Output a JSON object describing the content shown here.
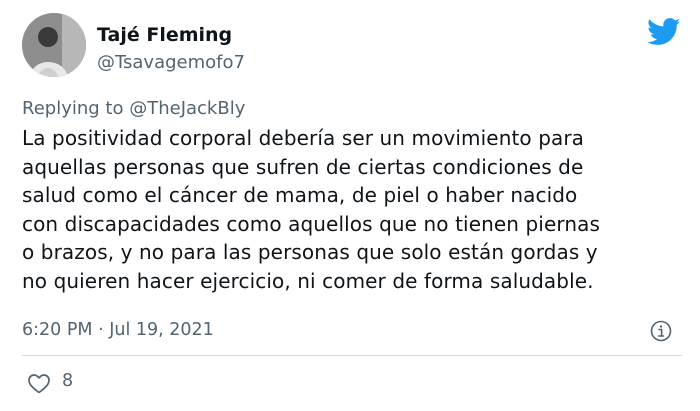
{
  "tweet": {
    "author_name": "Tajé Fleming",
    "author_handle": "@Tsavagemofo7",
    "replying_prefix": "Replying to",
    "replying_to": "@TheJackBly",
    "text": "La positividad corporal debería ser un movimiento para\naquellas personas que sufren de ciertas condiciones de\nsalud como el cáncer de mama, de piel o haber nacido\ncon discapacidades como aquellos que no tienen piernas\no brazos, y no para las personas que solo están gordas y\nno quieren hacer ejercicio, ni comer de forma saludable.",
    "timestamp": "6:20 PM · Jul 19, 2021",
    "like_count": "8"
  },
  "icons": {
    "brand": "twitter-bird-icon",
    "info": "info-icon",
    "like": "heart-icon"
  },
  "colors": {
    "brand": "#1d9bf0",
    "secondary_text": "#536471",
    "primary_text": "#0f1419",
    "divider": "#cfd9de"
  }
}
